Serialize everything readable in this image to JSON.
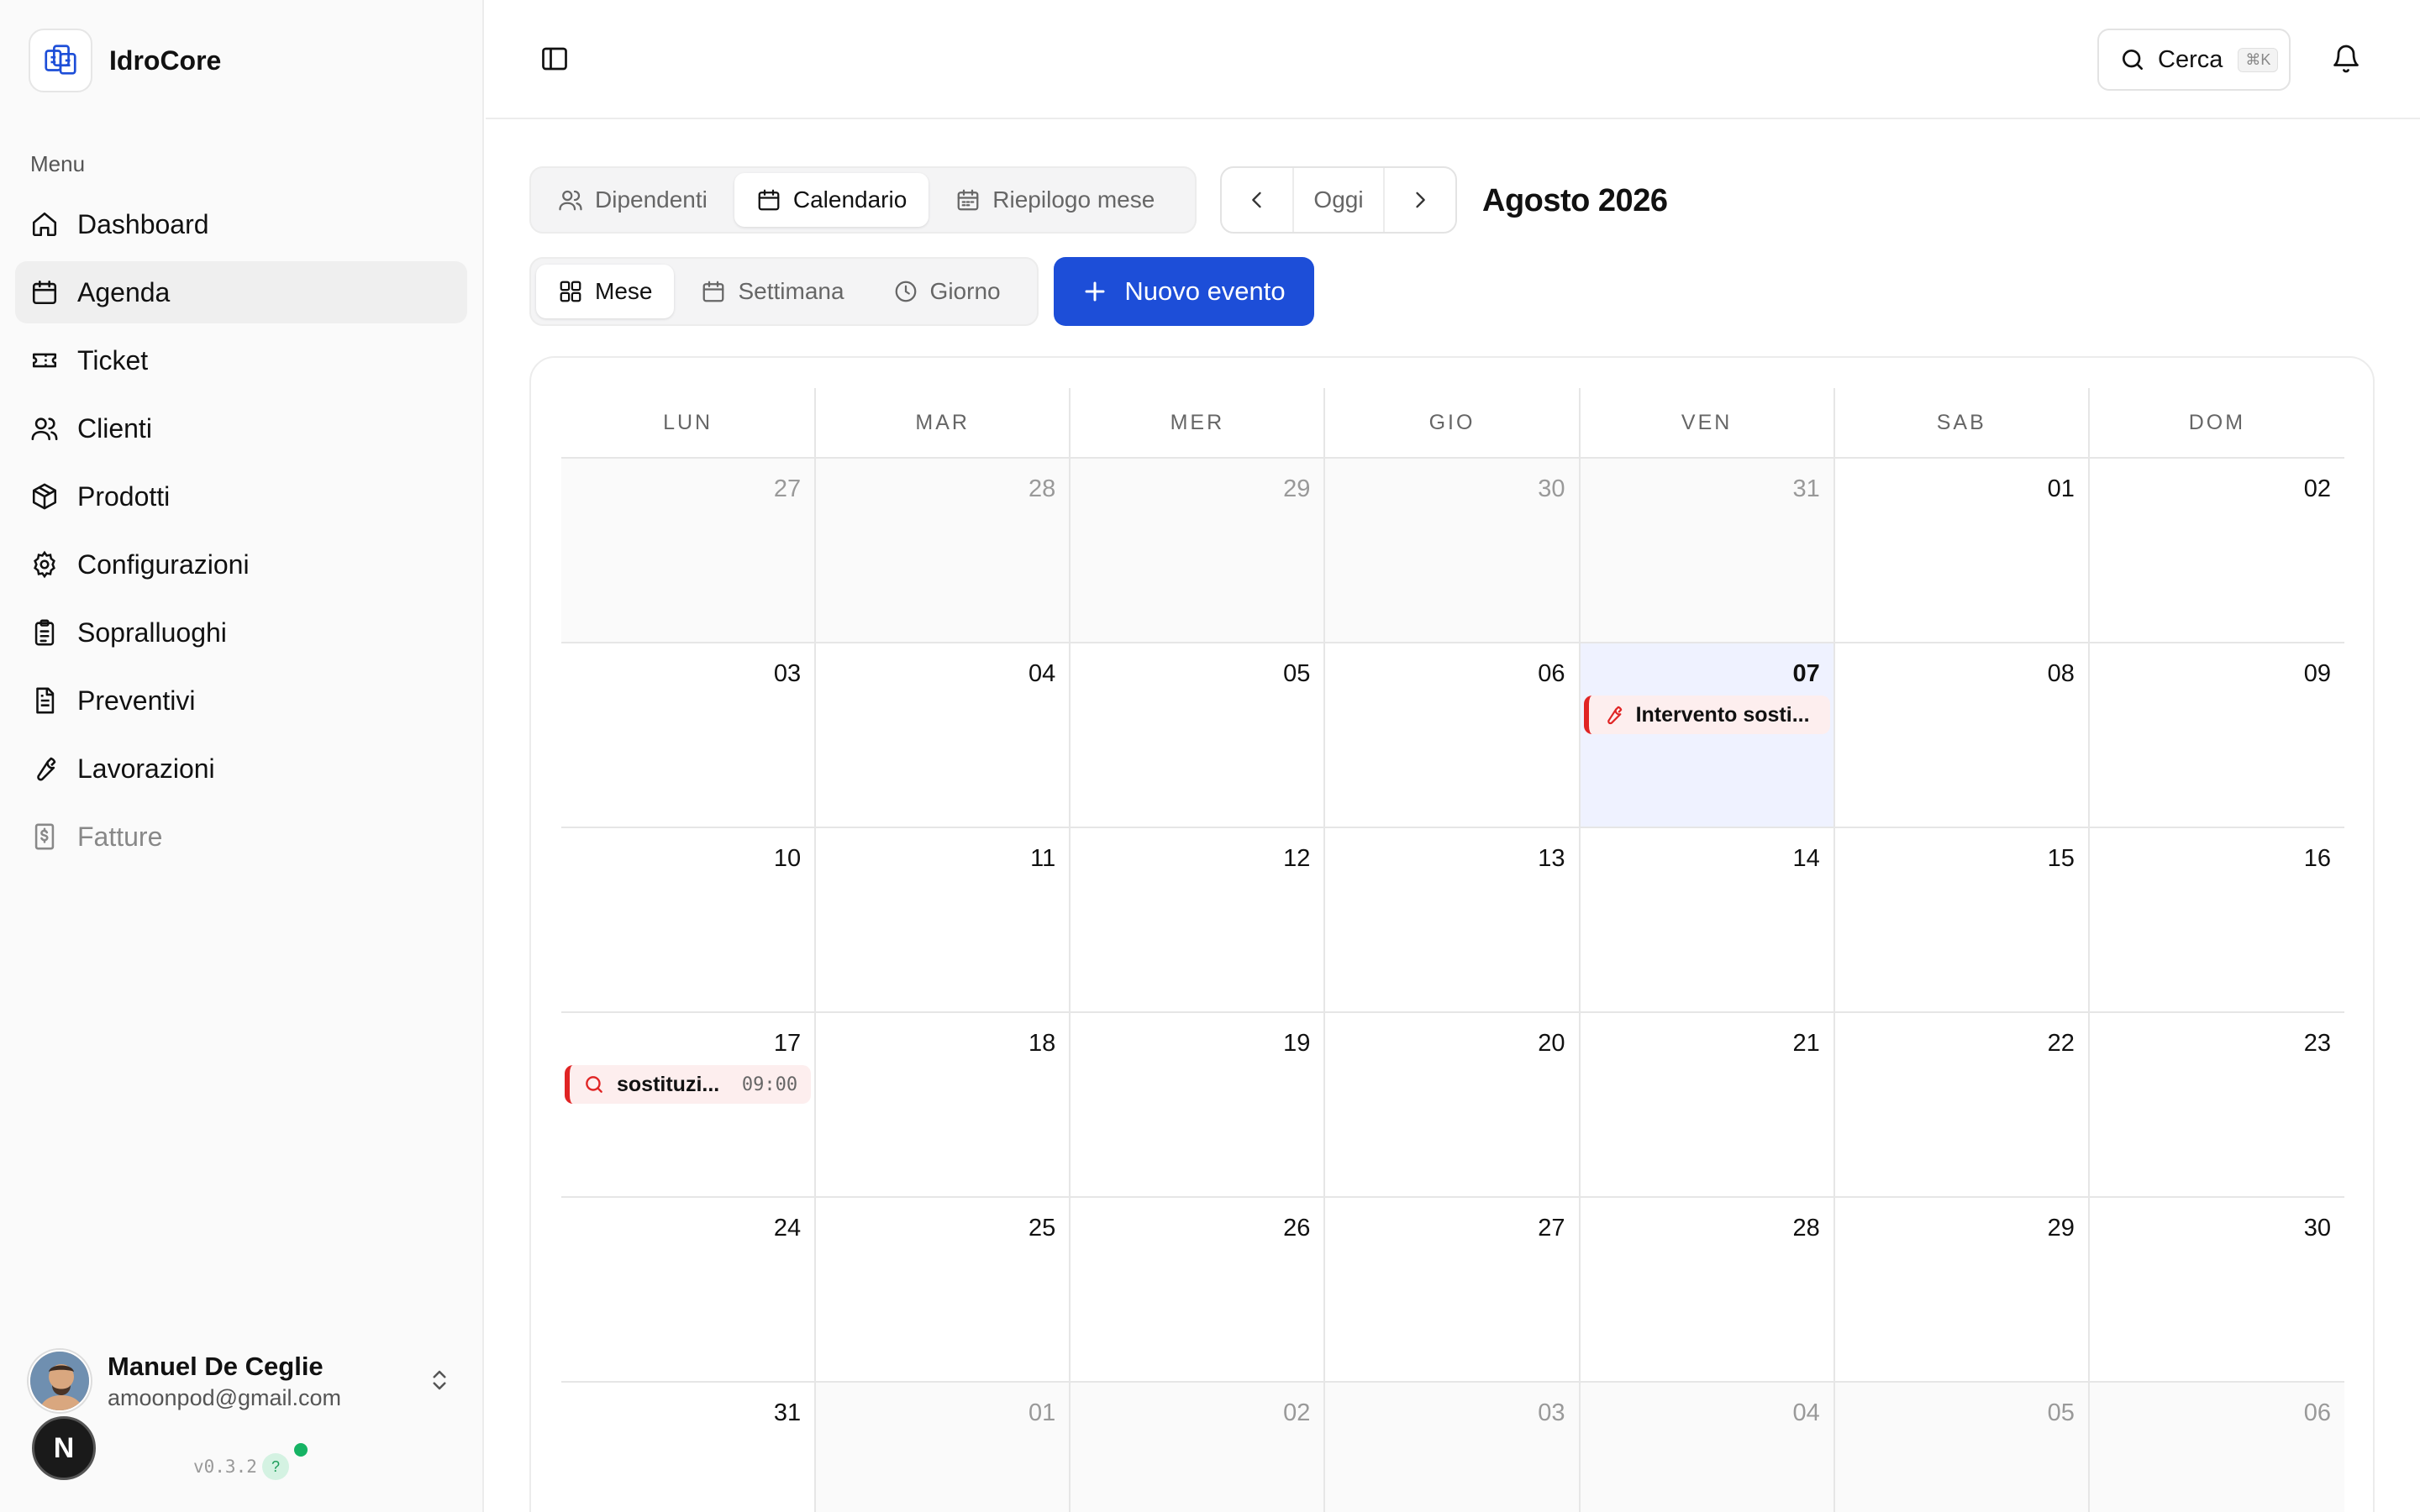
{
  "app": {
    "name": "IdroCore"
  },
  "sidebar": {
    "menu_label": "Menu",
    "items": [
      {
        "label": "Dashboard",
        "icon": "home-icon",
        "active": false
      },
      {
        "label": "Agenda",
        "icon": "calendar-icon",
        "active": true
      },
      {
        "label": "Ticket",
        "icon": "ticket-icon",
        "active": false
      },
      {
        "label": "Clienti",
        "icon": "users-icon",
        "active": false
      },
      {
        "label": "Prodotti",
        "icon": "package-icon",
        "active": false
      },
      {
        "label": "Configurazioni",
        "icon": "gear-icon",
        "active": false
      },
      {
        "label": "Sopralluoghi",
        "icon": "clipboard-icon",
        "active": false
      },
      {
        "label": "Preventivi",
        "icon": "file-text-icon",
        "active": false
      },
      {
        "label": "Lavorazioni",
        "icon": "wrench-icon",
        "active": false
      },
      {
        "label": "Fatture",
        "icon": "invoice-dollar-icon",
        "active": false,
        "disabled": true
      }
    ],
    "user": {
      "name": "Manuel De Ceglie",
      "email": "amoonpod@gmail.com"
    },
    "n_badge": "N",
    "version": "v0.3.2",
    "help": "?"
  },
  "header": {
    "search_label": "Cerca",
    "search_shortcut": "⌘K"
  },
  "toolbar": {
    "views": [
      {
        "label": "Dipendenti",
        "active": false
      },
      {
        "label": "Calendario",
        "active": true
      },
      {
        "label": "Riepilogo mese",
        "active": false
      }
    ],
    "today_label": "Oggi",
    "period_title": "Agosto 2026",
    "modes": [
      {
        "label": "Mese",
        "active": true
      },
      {
        "label": "Settimana",
        "active": false
      },
      {
        "label": "Giorno",
        "active": false
      }
    ],
    "new_event_label": "Nuovo evento",
    "accent_color": "#1d4ed8"
  },
  "calendar": {
    "weekdays": [
      "LUN",
      "MAR",
      "MER",
      "GIO",
      "VEN",
      "SAB",
      "DOM"
    ],
    "weeks": [
      [
        {
          "n": "27",
          "out": true
        },
        {
          "n": "28",
          "out": true
        },
        {
          "n": "29",
          "out": true
        },
        {
          "n": "30",
          "out": true
        },
        {
          "n": "31",
          "out": true
        },
        {
          "n": "01"
        },
        {
          "n": "02"
        }
      ],
      [
        {
          "n": "03"
        },
        {
          "n": "04"
        },
        {
          "n": "05"
        },
        {
          "n": "06"
        },
        {
          "n": "07",
          "today": true,
          "event": {
            "title": "Intervento sosti...",
            "icon": "wrench-icon"
          }
        },
        {
          "n": "08"
        },
        {
          "n": "09"
        }
      ],
      [
        {
          "n": "10"
        },
        {
          "n": "11"
        },
        {
          "n": "12"
        },
        {
          "n": "13"
        },
        {
          "n": "14"
        },
        {
          "n": "15"
        },
        {
          "n": "16"
        }
      ],
      [
        {
          "n": "17",
          "event": {
            "title": "sostituzi...",
            "time": "09:00",
            "icon": "search-icon"
          }
        },
        {
          "n": "18"
        },
        {
          "n": "19"
        },
        {
          "n": "20"
        },
        {
          "n": "21"
        },
        {
          "n": "22"
        },
        {
          "n": "23"
        }
      ],
      [
        {
          "n": "24"
        },
        {
          "n": "25"
        },
        {
          "n": "26"
        },
        {
          "n": "27"
        },
        {
          "n": "28"
        },
        {
          "n": "29"
        },
        {
          "n": "30"
        }
      ],
      [
        {
          "n": "31"
        },
        {
          "n": "01",
          "out": true
        },
        {
          "n": "02",
          "out": true
        },
        {
          "n": "03",
          "out": true
        },
        {
          "n": "04",
          "out": true
        },
        {
          "n": "05",
          "out": true
        },
        {
          "n": "06",
          "out": true
        }
      ]
    ],
    "event_color": "#e02424"
  }
}
